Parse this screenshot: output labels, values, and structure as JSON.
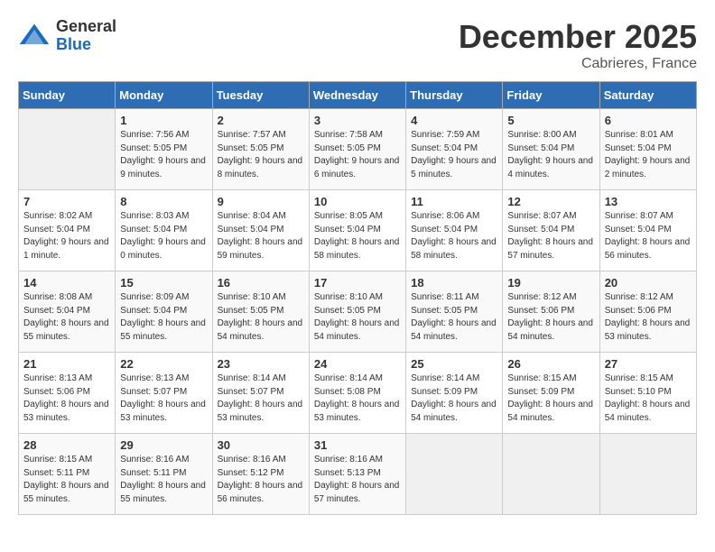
{
  "logo": {
    "general": "General",
    "blue": "Blue"
  },
  "title": "December 2025",
  "subtitle": "Cabrieres, France",
  "days_of_week": [
    "Sunday",
    "Monday",
    "Tuesday",
    "Wednesday",
    "Thursday",
    "Friday",
    "Saturday"
  ],
  "weeks": [
    [
      {
        "day": "",
        "info": ""
      },
      {
        "day": "1",
        "info": "Sunrise: 7:56 AM\nSunset: 5:05 PM\nDaylight: 9 hours\nand 9 minutes."
      },
      {
        "day": "2",
        "info": "Sunrise: 7:57 AM\nSunset: 5:05 PM\nDaylight: 9 hours\nand 8 minutes."
      },
      {
        "day": "3",
        "info": "Sunrise: 7:58 AM\nSunset: 5:05 PM\nDaylight: 9 hours\nand 6 minutes."
      },
      {
        "day": "4",
        "info": "Sunrise: 7:59 AM\nSunset: 5:04 PM\nDaylight: 9 hours\nand 5 minutes."
      },
      {
        "day": "5",
        "info": "Sunrise: 8:00 AM\nSunset: 5:04 PM\nDaylight: 9 hours\nand 4 minutes."
      },
      {
        "day": "6",
        "info": "Sunrise: 8:01 AM\nSunset: 5:04 PM\nDaylight: 9 hours\nand 2 minutes."
      }
    ],
    [
      {
        "day": "7",
        "info": "Sunrise: 8:02 AM\nSunset: 5:04 PM\nDaylight: 9 hours\nand 1 minute."
      },
      {
        "day": "8",
        "info": "Sunrise: 8:03 AM\nSunset: 5:04 PM\nDaylight: 9 hours\nand 0 minutes."
      },
      {
        "day": "9",
        "info": "Sunrise: 8:04 AM\nSunset: 5:04 PM\nDaylight: 8 hours\nand 59 minutes."
      },
      {
        "day": "10",
        "info": "Sunrise: 8:05 AM\nSunset: 5:04 PM\nDaylight: 8 hours\nand 58 minutes."
      },
      {
        "day": "11",
        "info": "Sunrise: 8:06 AM\nSunset: 5:04 PM\nDaylight: 8 hours\nand 58 minutes."
      },
      {
        "day": "12",
        "info": "Sunrise: 8:07 AM\nSunset: 5:04 PM\nDaylight: 8 hours\nand 57 minutes."
      },
      {
        "day": "13",
        "info": "Sunrise: 8:07 AM\nSunset: 5:04 PM\nDaylight: 8 hours\nand 56 minutes."
      }
    ],
    [
      {
        "day": "14",
        "info": "Sunrise: 8:08 AM\nSunset: 5:04 PM\nDaylight: 8 hours\nand 55 minutes."
      },
      {
        "day": "15",
        "info": "Sunrise: 8:09 AM\nSunset: 5:04 PM\nDaylight: 8 hours\nand 55 minutes."
      },
      {
        "day": "16",
        "info": "Sunrise: 8:10 AM\nSunset: 5:05 PM\nDaylight: 8 hours\nand 54 minutes."
      },
      {
        "day": "17",
        "info": "Sunrise: 8:10 AM\nSunset: 5:05 PM\nDaylight: 8 hours\nand 54 minutes."
      },
      {
        "day": "18",
        "info": "Sunrise: 8:11 AM\nSunset: 5:05 PM\nDaylight: 8 hours\nand 54 minutes."
      },
      {
        "day": "19",
        "info": "Sunrise: 8:12 AM\nSunset: 5:06 PM\nDaylight: 8 hours\nand 54 minutes."
      },
      {
        "day": "20",
        "info": "Sunrise: 8:12 AM\nSunset: 5:06 PM\nDaylight: 8 hours\nand 53 minutes."
      }
    ],
    [
      {
        "day": "21",
        "info": "Sunrise: 8:13 AM\nSunset: 5:06 PM\nDaylight: 8 hours\nand 53 minutes."
      },
      {
        "day": "22",
        "info": "Sunrise: 8:13 AM\nSunset: 5:07 PM\nDaylight: 8 hours\nand 53 minutes."
      },
      {
        "day": "23",
        "info": "Sunrise: 8:14 AM\nSunset: 5:07 PM\nDaylight: 8 hours\nand 53 minutes."
      },
      {
        "day": "24",
        "info": "Sunrise: 8:14 AM\nSunset: 5:08 PM\nDaylight: 8 hours\nand 53 minutes."
      },
      {
        "day": "25",
        "info": "Sunrise: 8:14 AM\nSunset: 5:09 PM\nDaylight: 8 hours\nand 54 minutes."
      },
      {
        "day": "26",
        "info": "Sunrise: 8:15 AM\nSunset: 5:09 PM\nDaylight: 8 hours\nand 54 minutes."
      },
      {
        "day": "27",
        "info": "Sunrise: 8:15 AM\nSunset: 5:10 PM\nDaylight: 8 hours\nand 54 minutes."
      }
    ],
    [
      {
        "day": "28",
        "info": "Sunrise: 8:15 AM\nSunset: 5:11 PM\nDaylight: 8 hours\nand 55 minutes."
      },
      {
        "day": "29",
        "info": "Sunrise: 8:16 AM\nSunset: 5:11 PM\nDaylight: 8 hours\nand 55 minutes."
      },
      {
        "day": "30",
        "info": "Sunrise: 8:16 AM\nSunset: 5:12 PM\nDaylight: 8 hours\nand 56 minutes."
      },
      {
        "day": "31",
        "info": "Sunrise: 8:16 AM\nSunset: 5:13 PM\nDaylight: 8 hours\nand 57 minutes."
      },
      {
        "day": "",
        "info": ""
      },
      {
        "day": "",
        "info": ""
      },
      {
        "day": "",
        "info": ""
      }
    ]
  ]
}
